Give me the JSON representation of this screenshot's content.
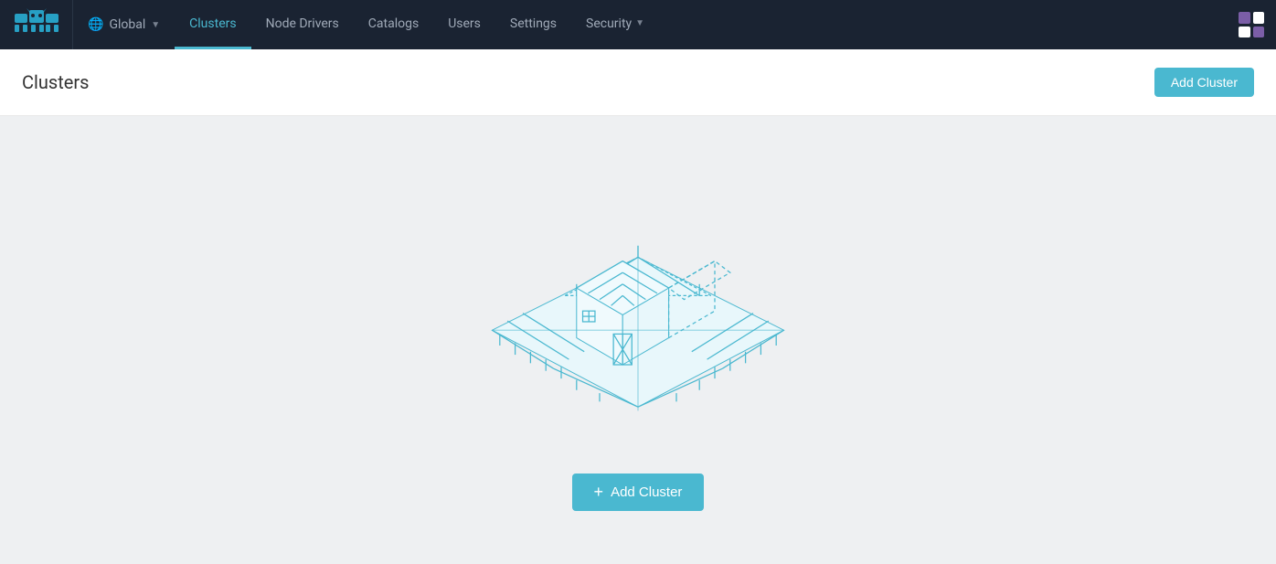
{
  "nav": {
    "logo_alt": "Rancher",
    "global_label": "Global",
    "items": [
      {
        "label": "Clusters",
        "active": true
      },
      {
        "label": "Node Drivers",
        "active": false
      },
      {
        "label": "Catalogs",
        "active": false
      },
      {
        "label": "Users",
        "active": false
      },
      {
        "label": "Settings",
        "active": false
      },
      {
        "label": "Security",
        "active": false,
        "has_dropdown": true
      }
    ]
  },
  "page": {
    "title": "Clusters",
    "add_cluster_button": "Add Cluster"
  },
  "empty_state": {
    "add_cluster_button": "Add Cluster",
    "plus_icon": "+"
  },
  "app_switcher": {
    "cells": [
      "purple",
      "white",
      "white",
      "purple"
    ]
  }
}
